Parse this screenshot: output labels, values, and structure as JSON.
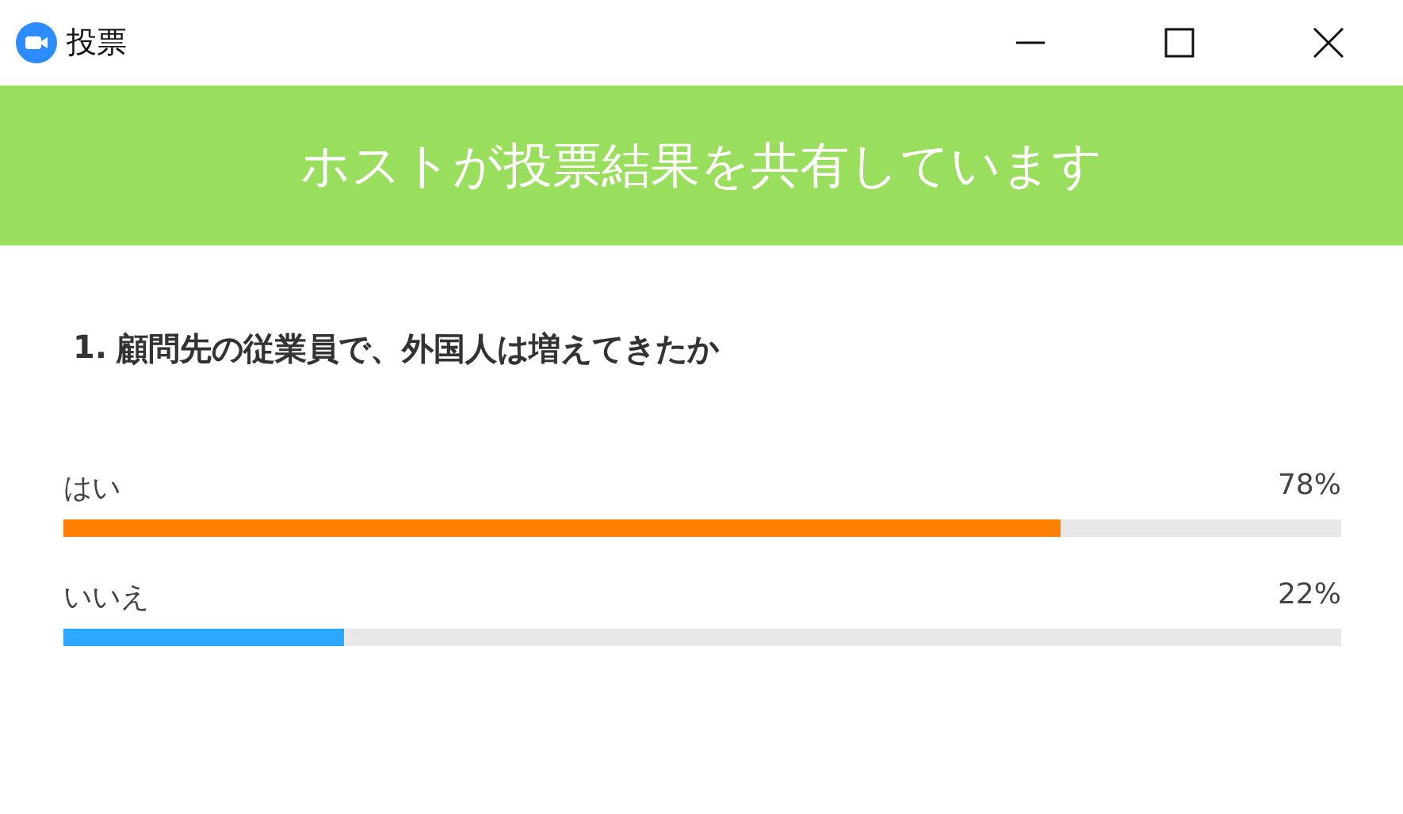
{
  "window": {
    "title": "投票"
  },
  "banner": {
    "text": "ホストが投票結果を共有しています"
  },
  "question": {
    "number": "1.",
    "text": "顧問先の従業員で、外国人は増えてきたか"
  },
  "options": [
    {
      "label": "はい",
      "reading": "78%",
      "level": 0.78,
      "color": "#ff7f00"
    },
    {
      "label": "いいえ",
      "reading": "22%",
      "level": 0.22,
      "color": "#2ea8ff"
    }
  ]
}
